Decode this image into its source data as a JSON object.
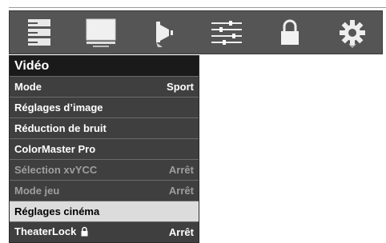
{
  "colors": {
    "icon_bar_bg": "#555555",
    "menu_bg": "#3f3f3f",
    "title_bg": "#1a1a1a",
    "selected_bg": "#dcdcdc",
    "disabled_text": "#9e9e9e"
  },
  "icon_bar": {
    "icons": [
      "list-menu-icon",
      "tv-screen-icon",
      "speaker-icon",
      "sliders-icon",
      "padlock-icon",
      "gear-icon"
    ]
  },
  "menu": {
    "title": "Vidéo",
    "items": [
      {
        "label": "Mode",
        "value": "Sport",
        "state": "normal"
      },
      {
        "label": "Réglages d’image",
        "value": "",
        "state": "normal"
      },
      {
        "label": "Réduction de bruit",
        "value": "",
        "state": "normal"
      },
      {
        "label": "ColorMaster Pro",
        "value": "",
        "state": "normal"
      },
      {
        "label": "Sélection xvYCC",
        "value": "Arrêt",
        "state": "disabled"
      },
      {
        "label": "Mode jeu",
        "value": "Arrêt",
        "state": "disabled"
      },
      {
        "label": "Réglages cinéma",
        "value": "",
        "state": "selected"
      },
      {
        "label": "TheaterLock",
        "value": "Arrêt",
        "state": "normal",
        "icon": "padlock-icon"
      }
    ]
  }
}
